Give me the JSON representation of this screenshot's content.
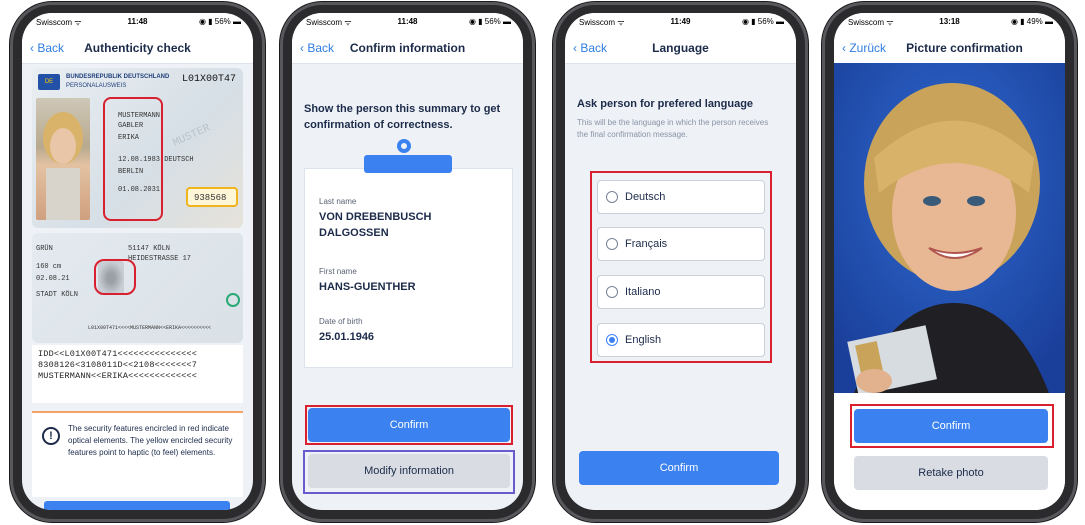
{
  "screens": [
    {
      "status": {
        "carrier": "Swisscom ᯤ",
        "time": "11:48",
        "battery": "◉ ▮ 56% ▬"
      },
      "nav": {
        "back": "‹ Back",
        "title": "Authenticity check"
      },
      "id_front": {
        "country": "BUNDESREPUBLIK DEUTSCHLAND",
        "doc_type": "PERSONALAUSWEIS",
        "doc_number": "L01X00T47",
        "surname": "MUSTERMANN",
        "birth_name": "GABLER",
        "given_name": "ERIKA",
        "dob": "12.08.1983 DEUTSCH",
        "place": "BERLIN",
        "expiry": "01.08.2031",
        "can": "938568",
        "specimen": "MUSTER"
      },
      "id_back": {
        "eyes": "GRÜN",
        "height": "160 cm",
        "issued": "02.08.21",
        "authority": "STADT KÖLN",
        "address_city": "51147 KÖLN",
        "address_street": "HEIDESTRASSE 17",
        "mrz_strip": "L01X00T471<<<<MUSTERMANN<<ERIKA<<<<<<<<<<"
      },
      "mrz": [
        "IDD<<L01X00T471<<<<<<<<<<<<<<<",
        "8308126<3108011D<<2108<<<<<<<7",
        "MUSTERMANN<<ERIKA<<<<<<<<<<<<<"
      ],
      "notice": {
        "icon": "!",
        "text": "The security features encircled in red indicate optical elements. The yellow encircled security features point to haptic (to feel) elements."
      }
    },
    {
      "status": {
        "carrier": "Swisscom ᯤ",
        "time": "11:48",
        "battery": "◉ ▮ 56% ▬"
      },
      "nav": {
        "back": "‹ Back",
        "title": "Confirm information"
      },
      "heading": "Show the person this summary to get confirmation of correctness.",
      "fields": [
        {
          "label": "Last name",
          "value": "VON DREBENBUSCH DALGOSSEN"
        },
        {
          "label": "First name",
          "value": "HANS-GUENTHER"
        },
        {
          "label": "Date of birth",
          "value": "25.01.1946"
        }
      ],
      "confirm": "Confirm",
      "modify": "Modify information"
    },
    {
      "status": {
        "carrier": "Swisscom ᯤ",
        "time": "11:49",
        "battery": "◉ ▮ 56% ▬"
      },
      "nav": {
        "back": "‹ Back",
        "title": "Language"
      },
      "heading": "Ask person for prefered language",
      "sub": "This will be the language in which the person receives the final confirmation message.",
      "options": [
        "Deutsch",
        "Français",
        "Italiano",
        "English"
      ],
      "selected": "English",
      "confirm": "Confirm"
    },
    {
      "status": {
        "carrier": "Swisscom ᯤ",
        "time": "13:18",
        "battery": "◉ ▮ 49% ▬"
      },
      "nav": {
        "back": "‹ Zurück",
        "title": "Picture confirmation"
      },
      "confirm": "Confirm",
      "retake": "Retake photo"
    }
  ],
  "colors": {
    "accent": "#3b82f0",
    "highlight_red": "#d8202f",
    "highlight_purple": "#6a5acd",
    "haptic_yellow": "#f0b41c",
    "notice_orange": "#f2a365"
  }
}
